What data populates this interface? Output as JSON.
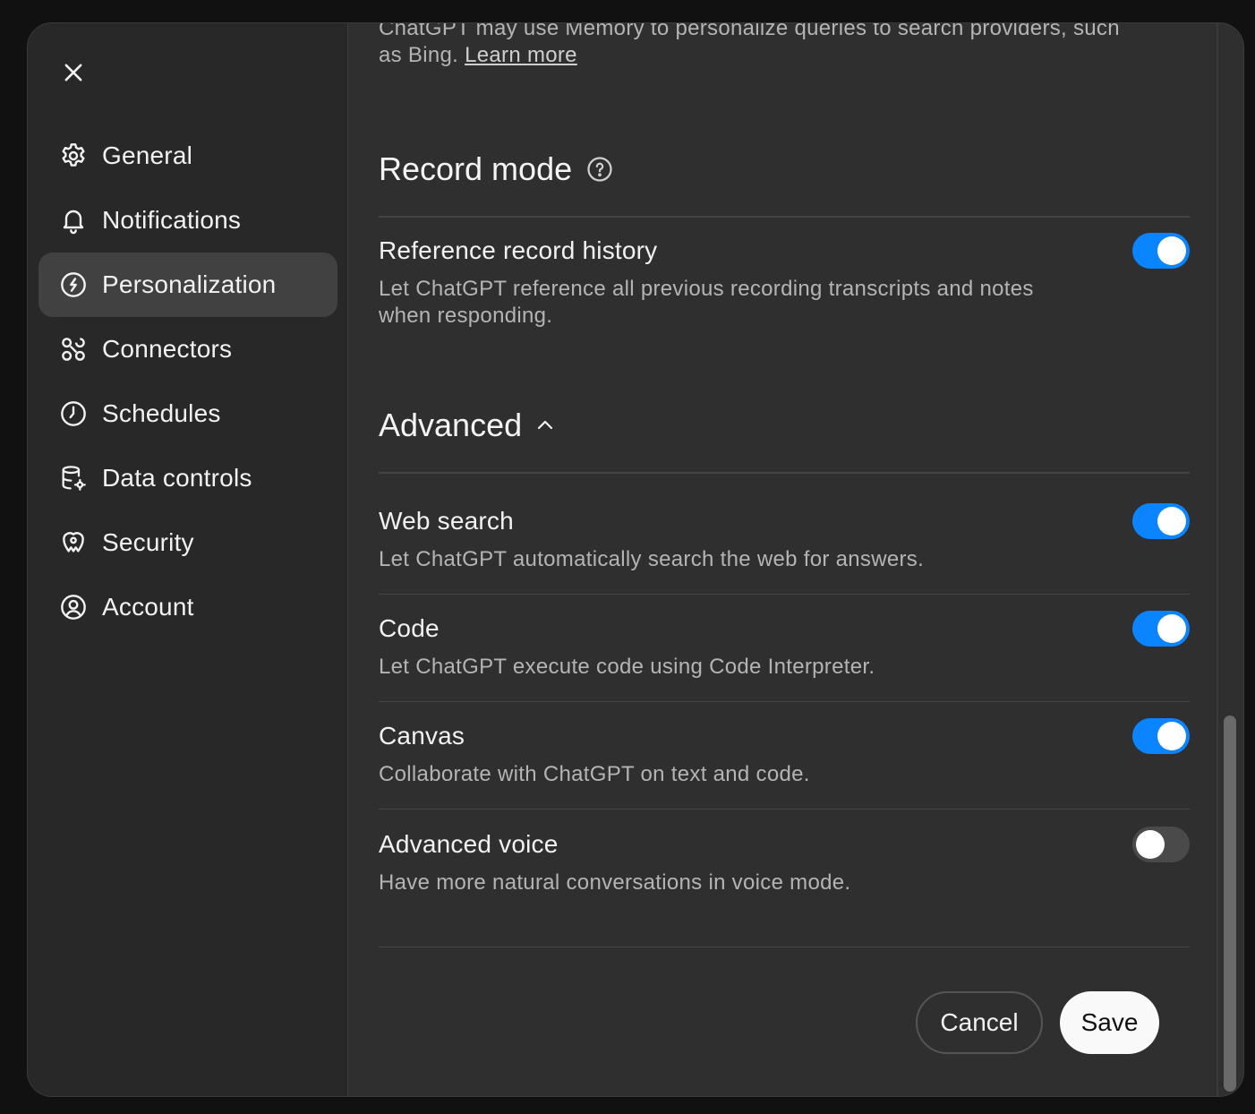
{
  "intro": {
    "text": "ChatGPT may use Memory to personalize queries to search providers, such as Bing.",
    "link": "Learn more"
  },
  "sidebar": {
    "close_icon": "close-icon",
    "items": [
      {
        "label": "General",
        "icon": "gear-icon"
      },
      {
        "label": "Notifications",
        "icon": "bell-icon"
      },
      {
        "label": "Personalization",
        "icon": "personalization-icon",
        "active": true
      },
      {
        "label": "Connectors",
        "icon": "connectors-icon"
      },
      {
        "label": "Schedules",
        "icon": "clock-icon"
      },
      {
        "label": "Data controls",
        "icon": "database-gear-icon"
      },
      {
        "label": "Security",
        "icon": "shield-icon"
      },
      {
        "label": "Account",
        "icon": "user-circle-icon"
      }
    ]
  },
  "record_mode": {
    "title": "Record mode",
    "help_icon": "help-icon",
    "reference": {
      "title": "Reference record history",
      "desc": "Let ChatGPT reference all previous recording transcripts and notes when responding.",
      "enabled": true
    }
  },
  "advanced": {
    "title": "Advanced",
    "chevron": "chevron-up-icon",
    "settings": [
      {
        "title": "Web search",
        "desc": "Let ChatGPT automatically search the web for answers.",
        "enabled": true
      },
      {
        "title": "Code",
        "desc": "Let ChatGPT execute code using Code Interpreter.",
        "enabled": true
      },
      {
        "title": "Canvas",
        "desc": "Collaborate with ChatGPT on text and code.",
        "enabled": true
      },
      {
        "title": "Advanced voice",
        "desc": "Have more natural conversations in voice mode.",
        "enabled": false
      }
    ]
  },
  "footer": {
    "cancel_label": "Cancel",
    "save_label": "Save"
  },
  "colors": {
    "toggle_on": "#0a84ff",
    "toggle_off": "#4a4a4a",
    "background": "#2f2f2f",
    "sidebar": "#282828"
  }
}
